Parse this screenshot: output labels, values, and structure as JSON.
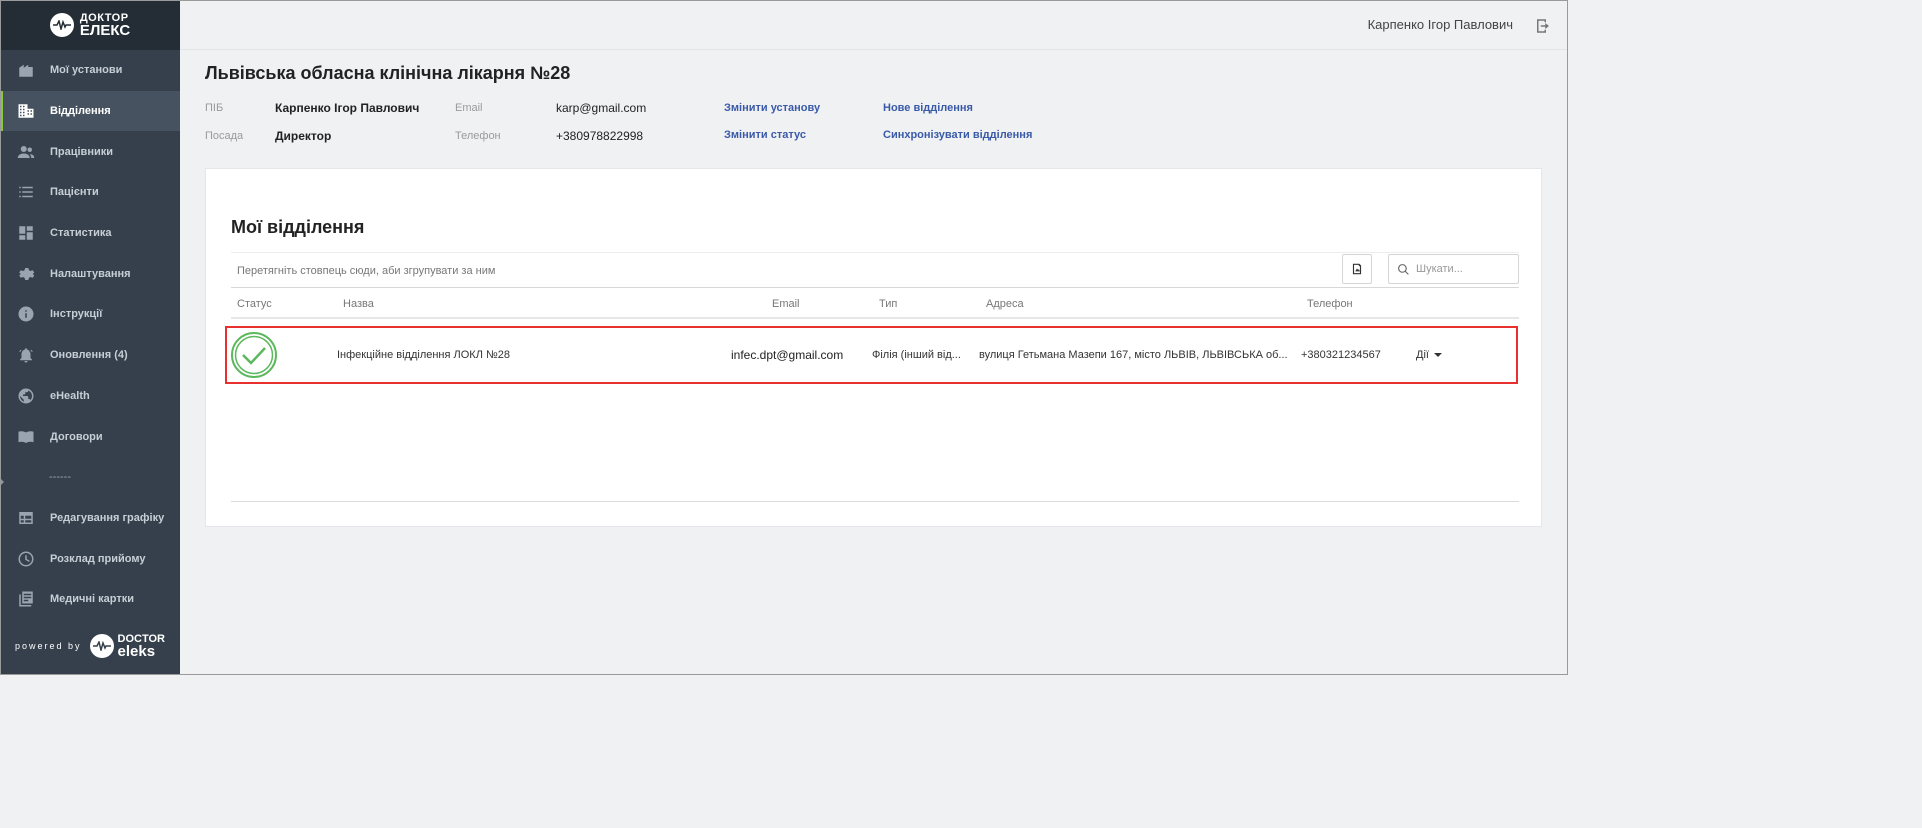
{
  "brand": {
    "logo_line1": "ДОКТОР",
    "logo_line2": "ЕЛЕКС",
    "powered_by": "powered by",
    "powered_line1": "DOCTOR",
    "powered_line2": "eleks"
  },
  "sidebar": {
    "items": [
      {
        "label": "Мої установи",
        "icon": "building-icon"
      },
      {
        "label": "Відділення",
        "icon": "department-icon",
        "active": true
      },
      {
        "label": "Працівники",
        "icon": "people-icon"
      },
      {
        "label": "Пацієнти",
        "icon": "list-icon"
      },
      {
        "label": "Статистика",
        "icon": "dashboard-icon"
      },
      {
        "label": "Налаштування",
        "icon": "gear-icon"
      },
      {
        "label": "Інструкції",
        "icon": "info-icon"
      },
      {
        "label": "Оновлення (4)",
        "icon": "bell-icon"
      },
      {
        "label": "eHealth",
        "icon": "globe-icon"
      },
      {
        "label": "Договори",
        "icon": "book-icon"
      },
      {
        "label": "------"
      },
      {
        "label": "Редагування графіку",
        "icon": "table-icon"
      },
      {
        "label": "Розклад прийому",
        "icon": "clock-icon"
      },
      {
        "label": "Медичні картки",
        "icon": "cards-icon"
      }
    ]
  },
  "header": {
    "user_name": "Карпенко Ігор Павлович"
  },
  "page": {
    "title": "Львівська обласна клінічна лікарня №28",
    "info": {
      "pib_label": "ПІБ",
      "pib_value": "Карпенко Ігор Павлович",
      "position_label": "Посада",
      "position_value": "Директор",
      "email_label": "Email",
      "email_value": "karp@gmail.com",
      "phone_label": "Телефон",
      "phone_value": "+380978822998"
    },
    "links": {
      "change_institution": "Змінити установу",
      "change_status": "Змінити статус",
      "new_department": "Нове відділення",
      "sync_departments": "Синхронізувати відділення"
    }
  },
  "departments": {
    "title": "Мої відділення",
    "group_hint": "Перетягніть стовпець сюди, аби згрупувати за ним",
    "search_placeholder": "Шукати...",
    "columns": [
      "Статус",
      "Назва",
      "Email",
      "Тип",
      "Адреса",
      "Телефон"
    ],
    "rows": [
      {
        "status": "active",
        "name": "Інфекційне відділення ЛОКЛ №28",
        "email": "infec.dpt@gmail.com",
        "type": "Філія (інший від...",
        "address": "вулиця Гетьмана Мазепи 167, місто ЛЬВІВ, ЛЬВІВСЬКА об...",
        "phone": "+380321234567",
        "actions_label": "Дії"
      }
    ]
  },
  "colors": {
    "sidebar_bg": "#35404c",
    "active_accent": "#8dc63f",
    "link": "#3a5aa8",
    "highlight": "#e8312f",
    "status_ok": "#5cb85c"
  }
}
